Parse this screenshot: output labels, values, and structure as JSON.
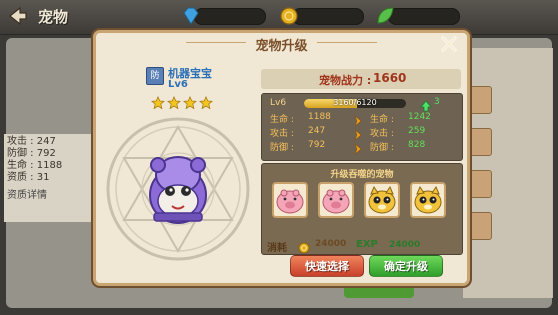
{
  "topbar": {
    "title": "宠物",
    "resources": [
      {
        "icon": "diamond-icon",
        "color": "#3fa1e0"
      },
      {
        "icon": "gold-coin-icon",
        "color": "#e6b020"
      },
      {
        "icon": "leaf-icon",
        "color": "#58c04a"
      }
    ]
  },
  "background_stats": {
    "attack": "攻击 : 247",
    "defense": "防御 : 792",
    "hp": "生命 : 1188",
    "aptitude": "资质 : 31",
    "detail_link": "资质详情"
  },
  "modal": {
    "title": "宠物升级",
    "pet": {
      "type_badge": "防",
      "name": "机器宝宝",
      "level": "Lv6",
      "stars": 4
    },
    "power_label": "宠物战力 :",
    "power_value": "1660",
    "level_current": "Lv6",
    "exp_text": "3160/6120",
    "exp_fraction": 0.52,
    "level_gain": "3",
    "stats": [
      {
        "label": "生命 :",
        "current": "1188",
        "label2": "生命 :",
        "next": "1242"
      },
      {
        "label": "攻击 :",
        "current": "247",
        "label2": "攻击 :",
        "next": "259"
      },
      {
        "label": "防御 :",
        "current": "792",
        "label2": "防御 :",
        "next": "828"
      }
    ],
    "feed_title": "升级吞噬的宠物",
    "feed_pets": [
      "pig-pet",
      "pig-pet",
      "cat-pet",
      "cat-pet"
    ],
    "cost_label": "消耗",
    "cost_value": "24000",
    "exp_label": "EXP",
    "exp_value": "24000",
    "btn_quick": "快速选择",
    "btn_confirm": "确定升级"
  },
  "colors": {
    "modal_bg": "#f0e8d4",
    "modal_border": "#c9a574",
    "stat_increase": "#5fe25a",
    "quick_button": "#c9402a",
    "confirm_button": "#2f9f2b"
  }
}
